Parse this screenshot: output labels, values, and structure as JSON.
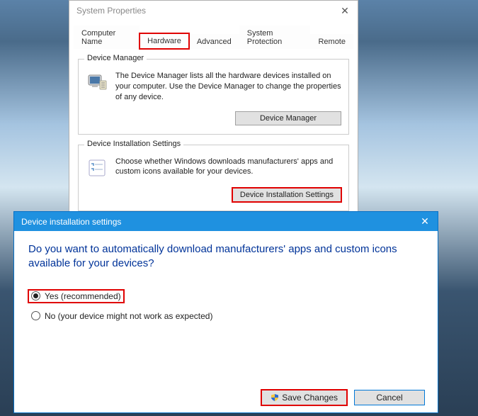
{
  "sysprops": {
    "title": "System Properties",
    "tabs": [
      "Computer Name",
      "Hardware",
      "Advanced",
      "System Protection",
      "Remote"
    ],
    "active_tab_index": 1,
    "device_manager": {
      "legend": "Device Manager",
      "desc": "The Device Manager lists all the hardware devices installed on your computer. Use the Device Manager to change the properties of any device.",
      "button": "Device Manager"
    },
    "device_install": {
      "legend": "Device Installation Settings",
      "desc": "Choose whether Windows downloads manufacturers' apps and custom icons available for your devices.",
      "button": "Device Installation Settings"
    }
  },
  "devinst": {
    "title": "Device installation settings",
    "question": "Do you want to automatically download manufacturers' apps and custom icons available for your devices?",
    "option_yes": "Yes (recommended)",
    "option_no": "No (your device might not work as expected)",
    "selected": "yes",
    "save": "Save Changes",
    "cancel": "Cancel"
  }
}
